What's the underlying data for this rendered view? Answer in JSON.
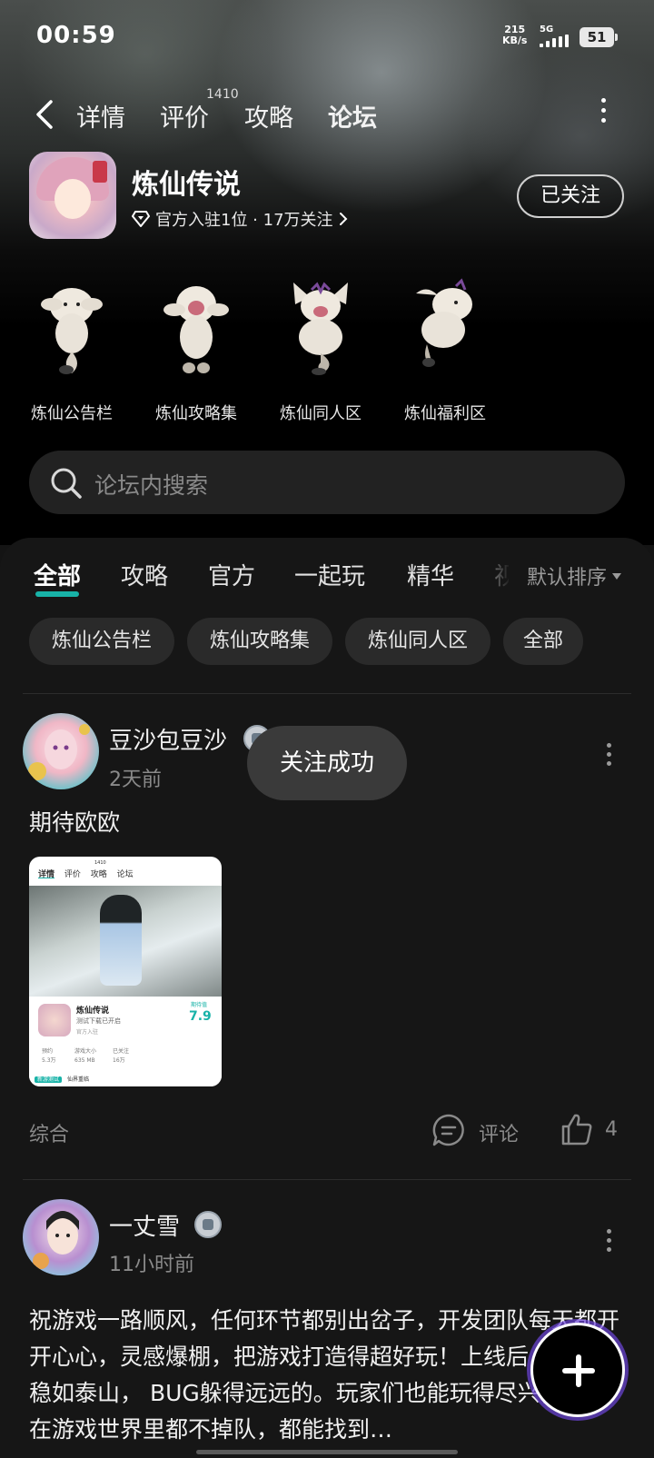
{
  "status_bar": {
    "time": "00:59",
    "net_speed_value": "215",
    "net_speed_unit": "KB/s",
    "network": "5G",
    "battery": "51"
  },
  "nav": {
    "tabs": [
      {
        "label": "详情"
      },
      {
        "label": "评价",
        "badge": "1410"
      },
      {
        "label": "攻略"
      },
      {
        "label": "论坛",
        "active": true
      }
    ]
  },
  "game": {
    "title": "炼仙传说",
    "meta": "官方入驻1位 · 17万关注",
    "follow_label": "已关注"
  },
  "boards": [
    {
      "label": "炼仙公告栏"
    },
    {
      "label": "炼仙攻略集"
    },
    {
      "label": "炼仙同人区"
    },
    {
      "label": "炼仙福利区"
    }
  ],
  "search": {
    "placeholder": "论坛内搜索"
  },
  "category_tabs": [
    {
      "label": "全部",
      "active": true
    },
    {
      "label": "攻略"
    },
    {
      "label": "官方"
    },
    {
      "label": "一起玩"
    },
    {
      "label": "精华"
    },
    {
      "label": "视"
    }
  ],
  "sort": {
    "label": "默认排序"
  },
  "chips": [
    {
      "label": "炼仙公告栏"
    },
    {
      "label": "炼仙攻略集"
    },
    {
      "label": "炼仙同人区"
    },
    {
      "label": "全部"
    }
  ],
  "toast": "关注成功",
  "posts": [
    {
      "author": "豆沙包豆沙",
      "time": "2天前",
      "text": "期待欧欧",
      "tag": "综合",
      "comment_label": "评论",
      "likes": "4",
      "thumb": {
        "tabs": [
          "详情",
          "评价",
          "攻略",
          "论坛"
        ],
        "badge": "1410",
        "title": "炼仙传说",
        "subtitle": "测试下载已开启",
        "official": "官方入驻",
        "score_label": "期待值",
        "score": "7.9",
        "stats": [
          {
            "label": "预约",
            "value": "5.3万"
          },
          {
            "label": "游戏大小",
            "value": "635 MB"
          },
          {
            "label": "已关注",
            "value": "16万"
          }
        ],
        "foot_badge": "新游测试",
        "foot_text": "仙界重临"
      }
    },
    {
      "author": "一丈雪",
      "time": "11小时前",
      "text": "祝游戏一路顺风，任何环节都别出岔子，开发团队每天都开开心心，灵感爆棚，把游戏打造得超好玩！上线后，服务器稳如泰山， BUG躲得远远的。玩家们也能玩得尽兴，大家在游戏世界里都不掉队，都能找到…"
    }
  ]
}
